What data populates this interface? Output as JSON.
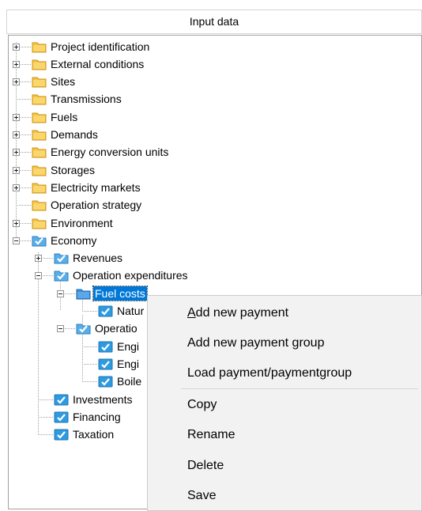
{
  "panel": {
    "title": "Input data"
  },
  "tree": [
    {
      "label": "Project identification",
      "icon": "folder",
      "expander": "plus"
    },
    {
      "label": "External conditions",
      "icon": "folder",
      "expander": "plus"
    },
    {
      "label": "Sites",
      "icon": "folder",
      "expander": "plus"
    },
    {
      "label": "Transmissions",
      "icon": "folder",
      "expander": "none"
    },
    {
      "label": "Fuels",
      "icon": "folder",
      "expander": "plus"
    },
    {
      "label": "Demands",
      "icon": "folder",
      "expander": "plus"
    },
    {
      "label": "Energy conversion units",
      "icon": "folder",
      "expander": "plus"
    },
    {
      "label": "Storages",
      "icon": "folder",
      "expander": "plus"
    },
    {
      "label": "Electricity markets",
      "icon": "folder",
      "expander": "plus"
    },
    {
      "label": "Operation strategy",
      "icon": "folder",
      "expander": "none"
    },
    {
      "label": "Environment",
      "icon": "folder",
      "expander": "plus"
    },
    {
      "label": "Economy",
      "icon": "checked-folder",
      "expander": "minus"
    },
    {
      "label": "Revenues",
      "icon": "checked-folder",
      "expander": "plus"
    },
    {
      "label": "Operation expenditures",
      "icon": "checked-folder",
      "expander": "minus"
    },
    {
      "label": "Fuel costs",
      "icon": "blue-folder",
      "expander": "minus",
      "selected": true
    },
    {
      "label": "Natur",
      "icon": "check-item",
      "expander": "none"
    },
    {
      "label": "Operatio",
      "icon": "checked-folder",
      "expander": "minus"
    },
    {
      "label": "Engi",
      "icon": "check-item",
      "expander": "none"
    },
    {
      "label": "Engi",
      "icon": "check-item",
      "expander": "none"
    },
    {
      "label": "Boile",
      "icon": "check-item",
      "expander": "none"
    },
    {
      "label": "Investments",
      "icon": "check-item",
      "expander": "none"
    },
    {
      "label": "Financing",
      "icon": "check-item",
      "expander": "none"
    },
    {
      "label": "Taxation",
      "icon": "check-item",
      "expander": "none"
    }
  ],
  "context_menu": {
    "items": [
      {
        "pre": "",
        "key": "A",
        "post": "dd new payment"
      },
      {
        "pre": "Add new payment ",
        "key": "g",
        "post": "roup"
      },
      {
        "pre": "Load payment/paymentgroup",
        "key": "",
        "post": ""
      },
      {
        "pre": "Copy",
        "key": "",
        "post": ""
      },
      {
        "pre": "Rename",
        "key": "",
        "post": ""
      },
      {
        "pre": "Delete",
        "key": "",
        "post": ""
      },
      {
        "pre": "Save",
        "key": "",
        "post": ""
      }
    ]
  },
  "colors": {
    "selection": "#0078d7",
    "folder": "#f5c242",
    "check": "#2e9be0"
  }
}
